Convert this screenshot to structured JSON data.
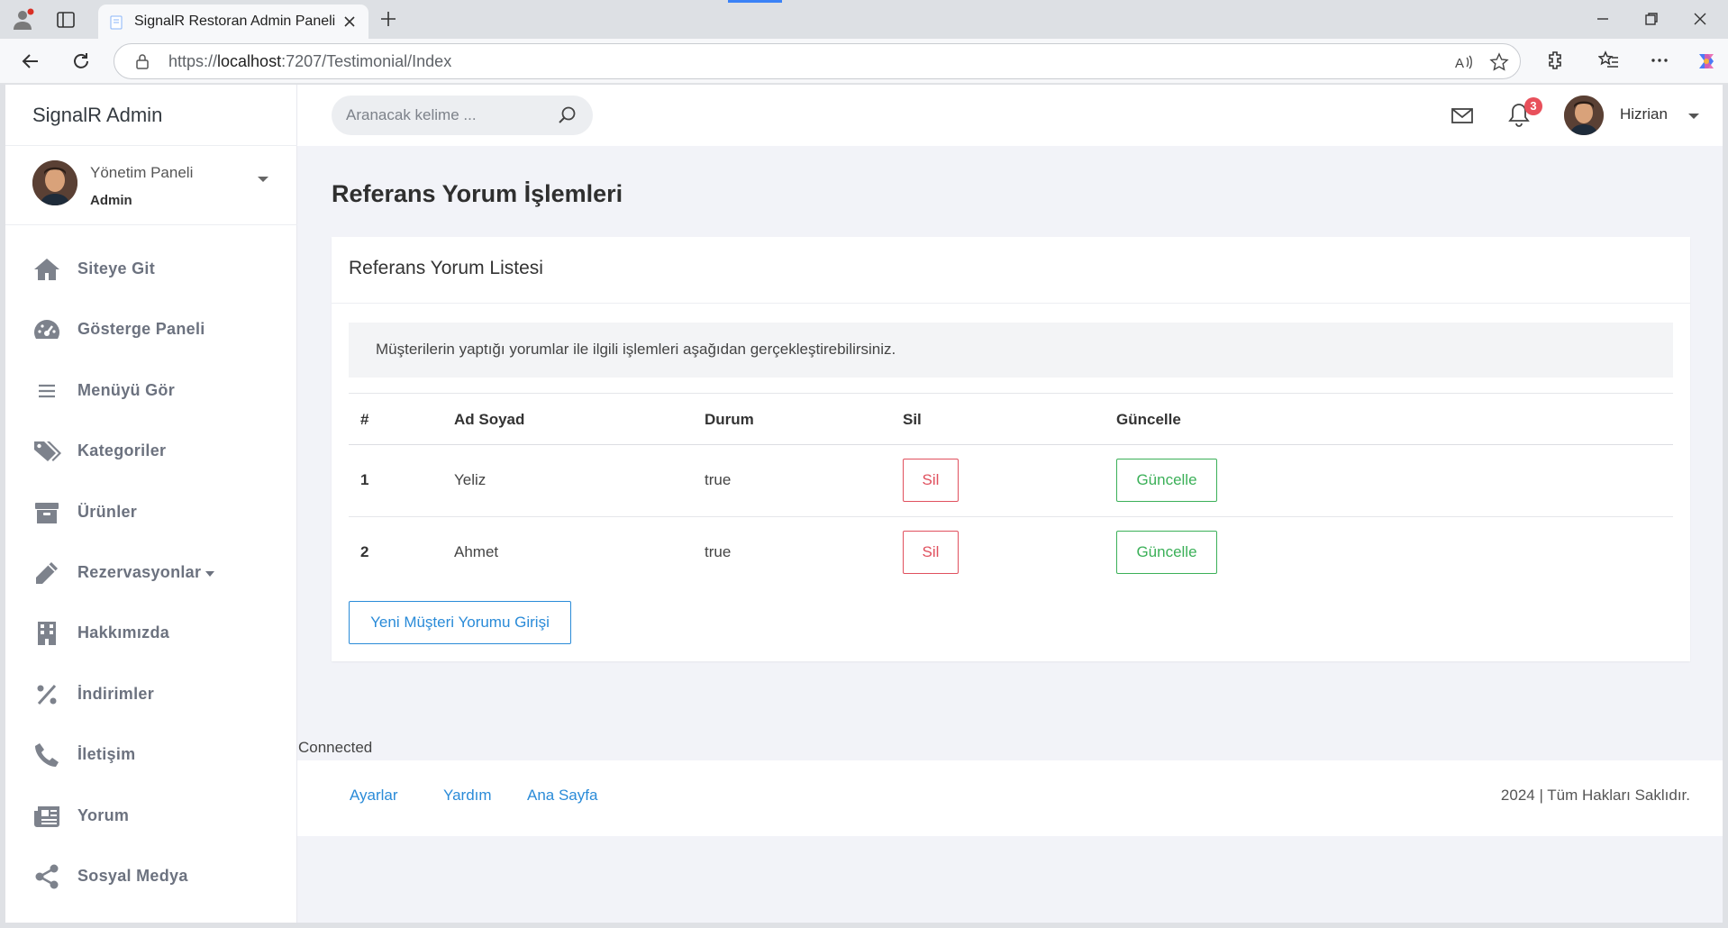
{
  "browser": {
    "tab_title": "SignalR Restoran Admin Paneli",
    "url_prefix": "https://",
    "url_host": "localhost",
    "url_rest": ":7207/Testimonial/Index"
  },
  "sidebar": {
    "brand": "SignalR Admin",
    "user": {
      "title": "Yönetim Paneli",
      "role": "Admin"
    },
    "items": [
      {
        "label": "Siteye Git",
        "icon": "home-icon"
      },
      {
        "label": "Gösterge Paneli",
        "icon": "dashboard-icon"
      },
      {
        "label": "Menüyü Gör",
        "icon": "menu-lines-icon"
      },
      {
        "label": "Kategoriler",
        "icon": "tags-icon"
      },
      {
        "label": "Ürünler",
        "icon": "archive-icon"
      },
      {
        "label": "Rezervasyonlar",
        "icon": "pencil-icon",
        "has_submenu": true
      },
      {
        "label": "Hakkımızda",
        "icon": "building-icon"
      },
      {
        "label": "İndirimler",
        "icon": "percent-icon"
      },
      {
        "label": "İletişim",
        "icon": "phone-icon"
      },
      {
        "label": "Yorum",
        "icon": "newspaper-icon"
      },
      {
        "label": "Sosyal Medya",
        "icon": "share-icon"
      }
    ]
  },
  "topnav": {
    "search_placeholder": "Aranacak kelime ...",
    "notification_count": "3",
    "user_name": "Hizrian"
  },
  "page": {
    "title": "Referans Yorum İşlemleri",
    "card_title": "Referans Yorum Listesi",
    "info_text": "Müşterilerin yaptığı yorumlar ile ilgili işlemleri aşağıdan gerçekleştirebilirsiniz.",
    "table": {
      "headers": [
        "#",
        "Ad Soyad",
        "Durum",
        "Sil",
        "Güncelle"
      ],
      "rows": [
        {
          "num": "1",
          "name": "Yeliz",
          "status": "true",
          "delete_label": "Sil",
          "update_label": "Güncelle"
        },
        {
          "num": "2",
          "name": "Ahmet",
          "status": "true",
          "delete_label": "Sil",
          "update_label": "Güncelle"
        }
      ]
    },
    "new_button": "Yeni Müşteri Yorumu Girişi"
  },
  "status_text": "Connected",
  "footer": {
    "links": [
      "Ayarlar",
      "Yardım",
      "Ana Sayfa"
    ],
    "copyright": "2024 | Tüm Hakları Saklıdır."
  },
  "colors": {
    "danger": "#e0505e",
    "success": "#3bb058",
    "primary": "#2a8bd8",
    "badge": "#e8505b"
  }
}
